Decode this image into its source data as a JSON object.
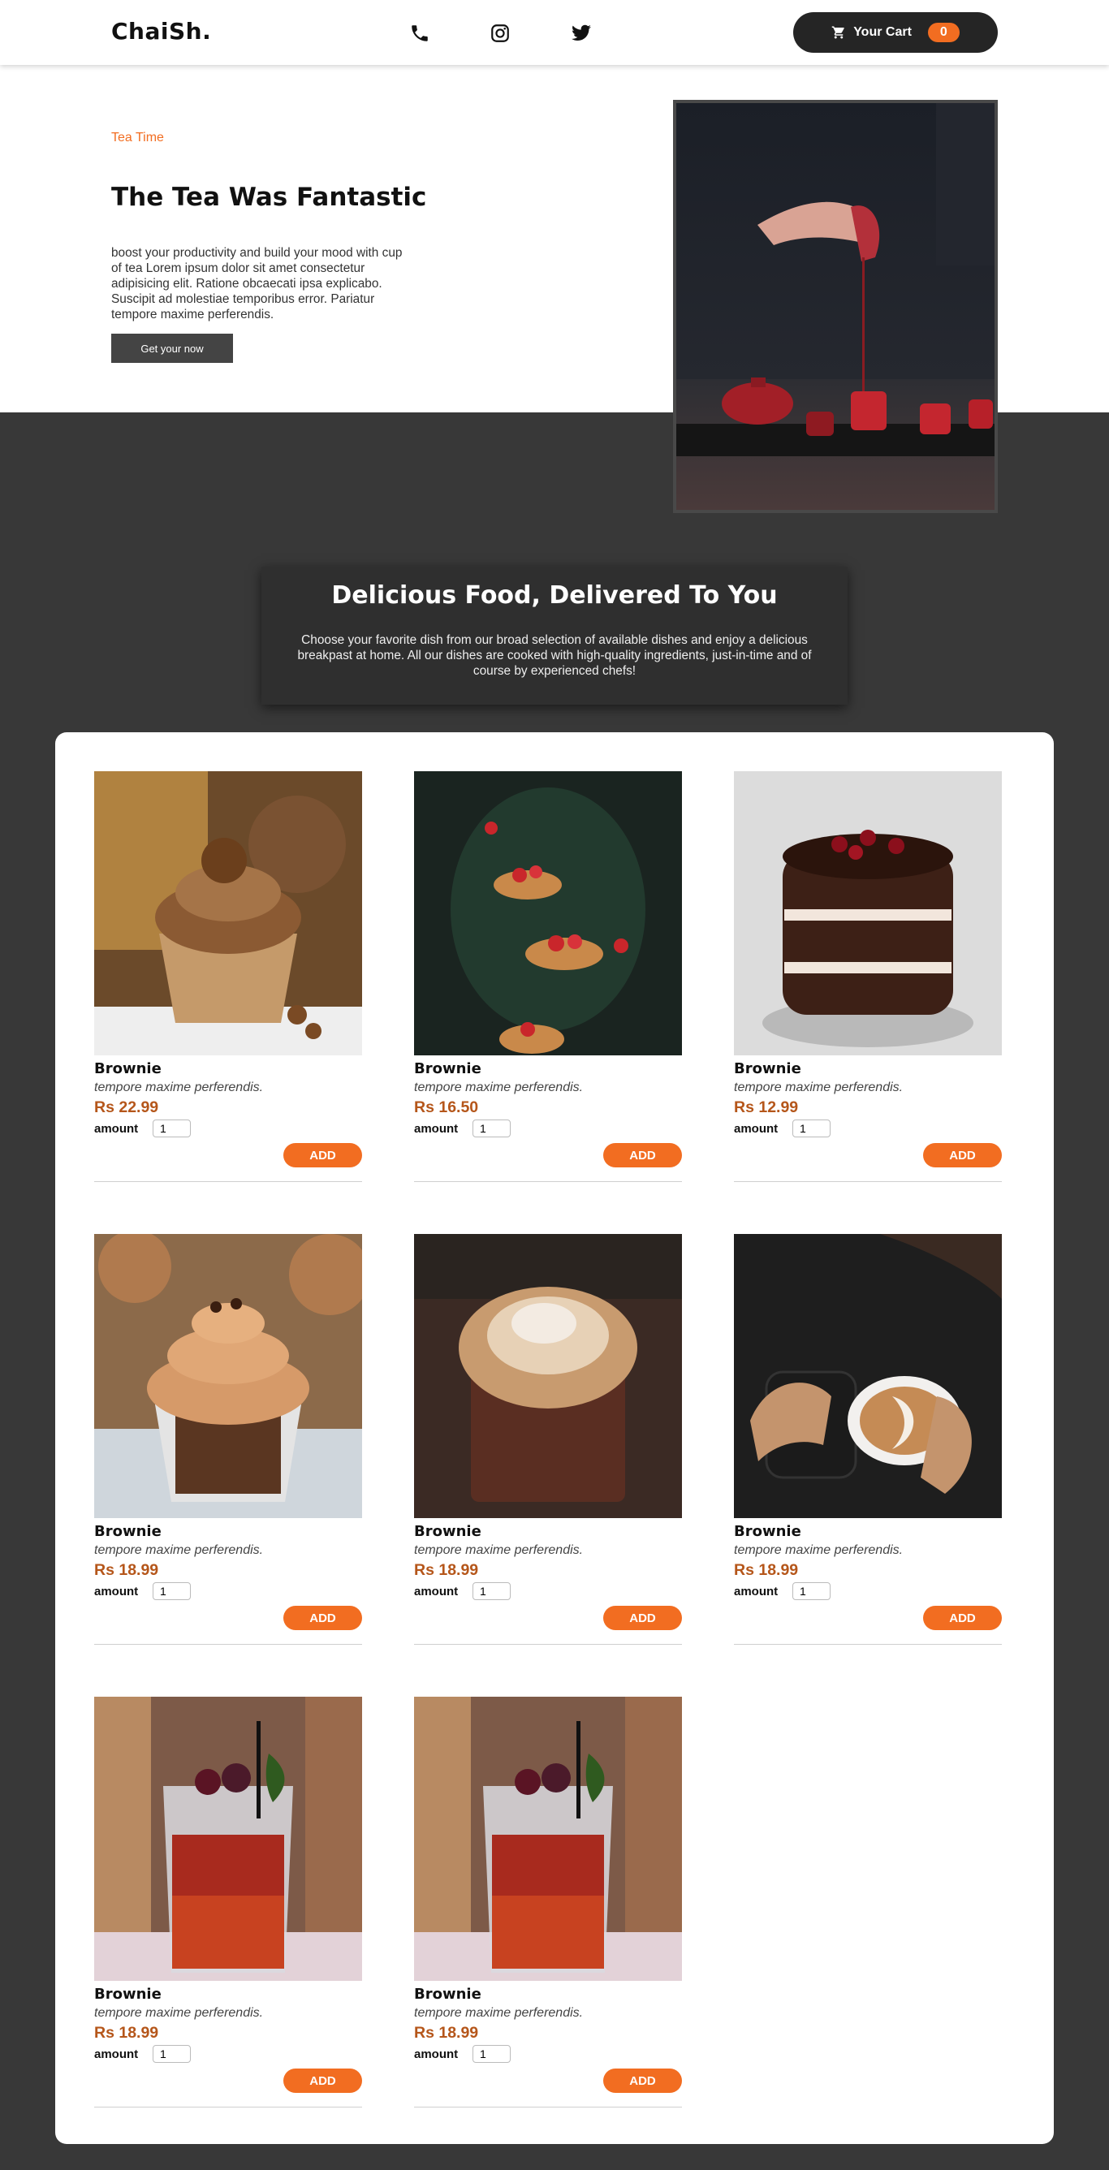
{
  "header": {
    "logo": "ChaiSh.",
    "cart_label": "Your Cart",
    "cart_count": "0"
  },
  "hero": {
    "eyebrow": "Tea Time",
    "title": "The Tea Was Fantastic",
    "text": "boost your productivity and build your mood with cup of tea Lorem ipsum dolor sit amet consectetur adipisicing elit. Ratione obcaecati ipsa explicabo. Suscipit ad molestiae temporibus error. Pariatur tempore maxime perferendis.",
    "cta": "Get your now"
  },
  "intro": {
    "title": "Delicious Food, Delivered To You",
    "text": "Choose your favorite dish from our broad selection of available dishes and enjoy a delicious breakpast at home. All our dishes are cooked with high-quality ingredients, just-in-time and of course by experienced chefs!"
  },
  "meals": [
    {
      "name": "Brownie",
      "desc": "tempore maxime perferendis.",
      "price": "Rs 22.99",
      "amount_label": "amount",
      "amount": "1",
      "add_label": "ADD"
    },
    {
      "name": "Brownie",
      "desc": "tempore maxime perferendis.",
      "price": "Rs 16.50",
      "amount_label": "amount",
      "amount": "1",
      "add_label": "ADD"
    },
    {
      "name": "Brownie",
      "desc": "tempore maxime perferendis.",
      "price": "Rs 12.99",
      "amount_label": "amount",
      "amount": "1",
      "add_label": "ADD"
    },
    {
      "name": "Brownie",
      "desc": "tempore maxime perferendis.",
      "price": "Rs 18.99",
      "amount_label": "amount",
      "amount": "1",
      "add_label": "ADD"
    },
    {
      "name": "Brownie",
      "desc": "tempore maxime perferendis.",
      "price": "Rs 18.99",
      "amount_label": "amount",
      "amount": "1",
      "add_label": "ADD"
    },
    {
      "name": "Brownie",
      "desc": "tempore maxime perferendis.",
      "price": "Rs 18.99",
      "amount_label": "amount",
      "amount": "1",
      "add_label": "ADD"
    },
    {
      "name": "Brownie",
      "desc": "tempore maxime perferendis.",
      "price": "Rs 18.99",
      "amount_label": "amount",
      "amount": "1",
      "add_label": "ADD"
    },
    {
      "name": "Brownie",
      "desc": "tempore maxime perferendis.",
      "price": "Rs 18.99",
      "amount_label": "amount",
      "amount": "1",
      "add_label": "ADD"
    }
  ],
  "colors": {
    "accent": "#f26d21",
    "price": "#b5561a",
    "dark_bg": "#383838",
    "cart_bg": "#252525"
  },
  "icons": [
    "phone-icon",
    "instagram-icon",
    "twitter-icon",
    "cart-icon"
  ]
}
